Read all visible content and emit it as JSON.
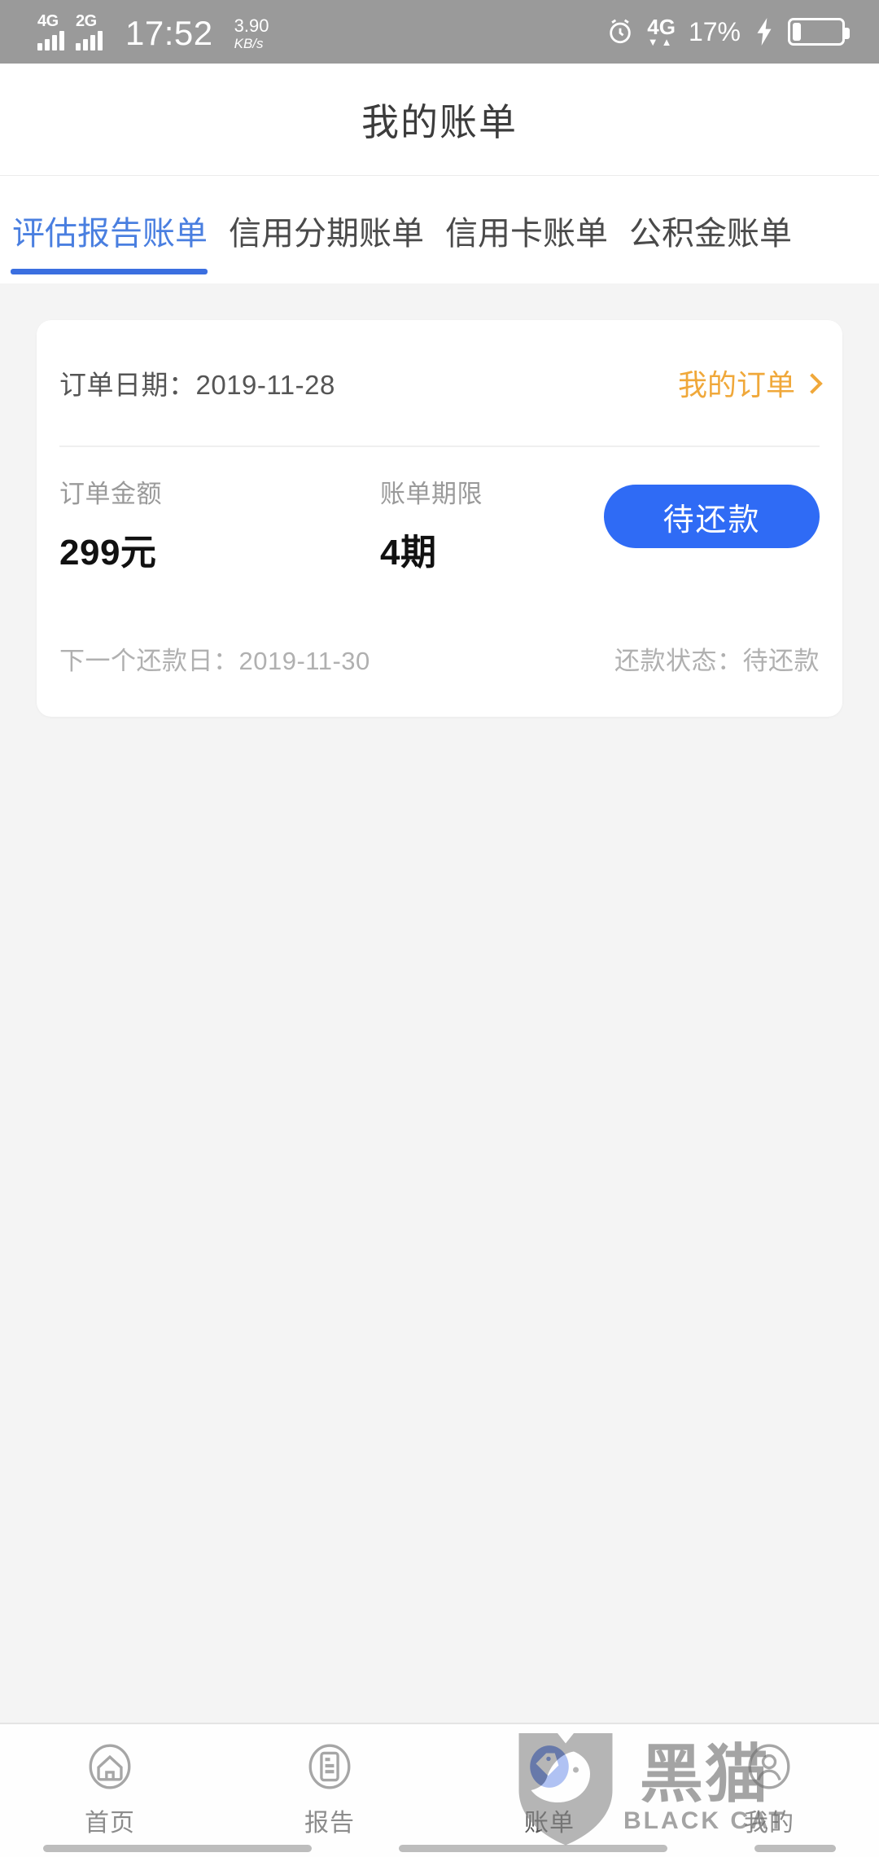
{
  "status_bar": {
    "network_1": "4G",
    "network_2": "2G",
    "time": "17:52",
    "speed_value": "3.90",
    "speed_unit": "KB/s",
    "alarm_icon": "alarm-clock-icon",
    "data_network": "4G",
    "data_network_sub": "1",
    "battery_percent": "17%",
    "charging_icon": "lightning-bolt-icon",
    "battery_icon": "battery-icon",
    "bg_color": "#9a9a9a"
  },
  "header": {
    "title": "我的账单"
  },
  "tabs": {
    "active_index": 0,
    "accent_color": "#3b6fe0",
    "items": [
      {
        "label": "评估报告账单"
      },
      {
        "label": "信用分期账单"
      },
      {
        "label": "信用卡账单"
      },
      {
        "label": "公积金账单"
      }
    ]
  },
  "bill_card": {
    "order_date_label": "订单日期：",
    "order_date_value": "2019-11-28",
    "order_date_full": "订单日期：2019-11-28",
    "my_orders_link": "我的订单",
    "my_orders_color": "#f0a83a",
    "chevron_icon": "chevron-right-icon",
    "amount_label": "订单金额",
    "amount_value": "299元",
    "term_label": "账单期限",
    "term_value": "4期",
    "action_button_label": "待还款",
    "action_button_color": "#2f6bf5",
    "next_repay_date": "下一个还款日：2019-11-30",
    "repay_status": "还款状态：待还款"
  },
  "bottom_nav": {
    "active_index": 2,
    "active_color": "#2f5fe0",
    "items": [
      {
        "label": "首页",
        "icon": "home-icon"
      },
      {
        "label": "报告",
        "icon": "report-document-icon"
      },
      {
        "label": "账单",
        "icon": "bill-tag-icon"
      },
      {
        "label": "我的",
        "icon": "user-profile-icon"
      }
    ]
  },
  "watermark": {
    "cn": "黑猫",
    "en": "BLACK CAT",
    "shield_icon": "black-cat-shield-icon"
  }
}
